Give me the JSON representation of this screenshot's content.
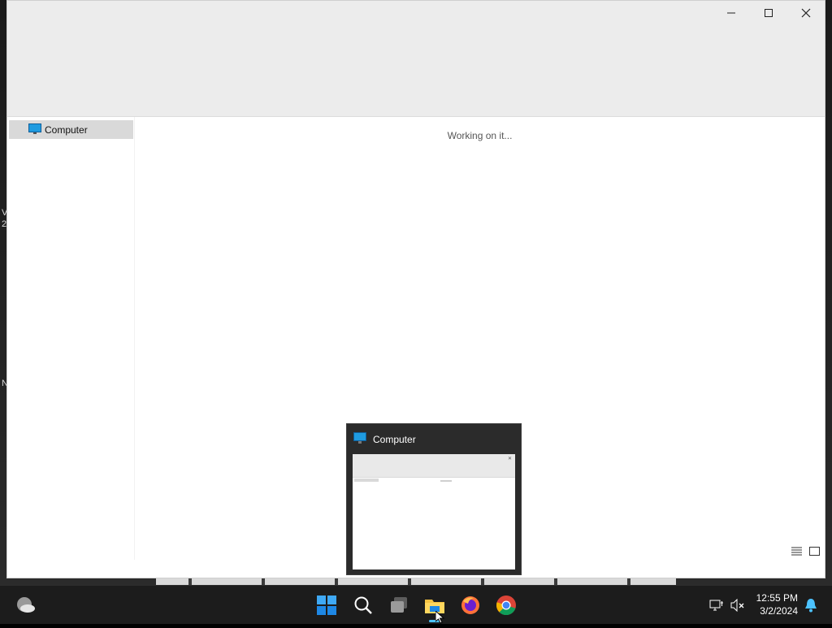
{
  "window": {
    "title": "Computer",
    "caption_buttons": [
      "minimize",
      "maximize",
      "close"
    ],
    "status_text": "Working on it..."
  },
  "nav_pane": {
    "items": [
      {
        "label": "Computer",
        "icon": "monitor-icon",
        "selected": true
      }
    ]
  },
  "desktop": {
    "left_edge_text": [
      "V",
      "2",
      "N"
    ]
  },
  "thumbnail_preview": {
    "title": "Computer",
    "icon": "monitor-icon",
    "mini_label": "Computer",
    "mini_status": "Working on it..."
  },
  "taskbar": {
    "items": [
      {
        "name": "weather-widget",
        "icon": "weather-icon"
      },
      {
        "name": "start",
        "icon": "windows-logo-icon"
      },
      {
        "name": "search",
        "icon": "search-icon"
      },
      {
        "name": "task-view",
        "icon": "task-view-icon"
      },
      {
        "name": "file-explorer",
        "icon": "folder-icon",
        "active": true
      },
      {
        "name": "firefox",
        "icon": "firefox-icon"
      },
      {
        "name": "chrome",
        "icon": "chrome-icon"
      }
    ],
    "tray": {
      "network_icon": "network-icon",
      "volume_icon": "volume-muted-icon",
      "notification_icon": "bell-icon"
    },
    "clock": {
      "time": "12:55 PM",
      "date": "3/2/2024"
    }
  },
  "colors": {
    "accent": "#4cc2ff",
    "taskbar_bg": "#1c1c1c",
    "titlebar_bg": "#ececec",
    "selection_bg": "#d9d9d9"
  }
}
